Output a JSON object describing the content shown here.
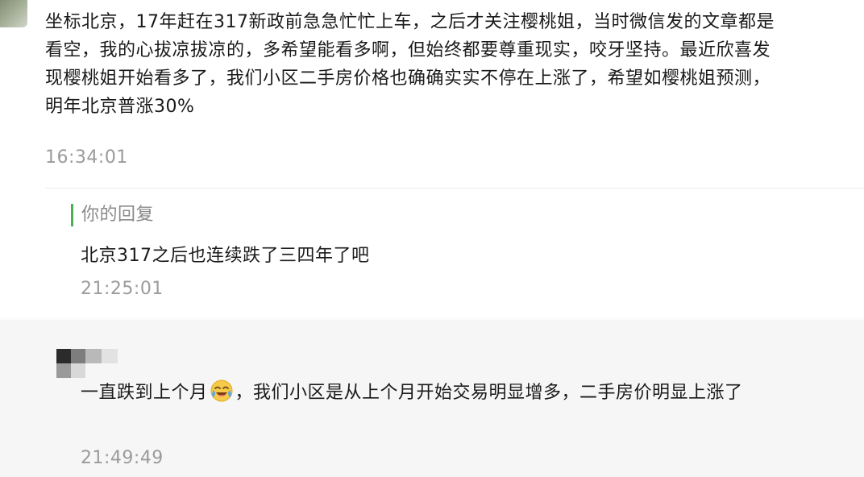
{
  "comment": {
    "text": "坐标北京，17年赶在317新政前急急忙忙上车，之后才关注樱桃姐，当时微信发的文章都是看空，我的心拔凉拔凉的，多希望能看多啊，但始终都要尊重现实，咬牙坚持。最近欣喜发现樱桃姐开始看多了，我们小区二手房价格也确确实实不停在上涨了，希望如樱桃姐预测，明年北京普涨30%",
    "time": "16:34:01"
  },
  "reply": {
    "label": "你的回复",
    "text": "北京317之后也连续跌了三四年了吧",
    "time": "21:25:01"
  },
  "followup": {
    "text_before_emoji": "一直跌到上个月",
    "emoji": "crying-laughing-emoji",
    "text_after_emoji": "，我们小区是从上个月开始交易明显增多，二手房价明显上涨了",
    "time": "21:49:49"
  },
  "colors": {
    "reply_accent": "#4caf50",
    "timestamp": "#9b9b9b",
    "followup_background": "#f6f6f6"
  }
}
